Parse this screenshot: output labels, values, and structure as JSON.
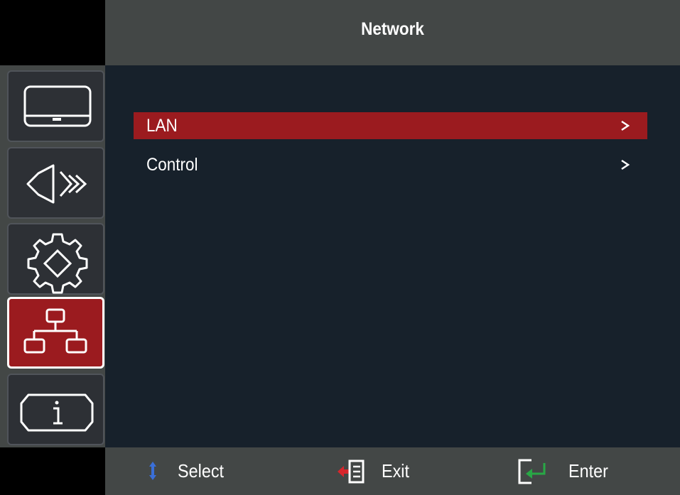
{
  "header": {
    "title": "Network"
  },
  "sidebar": {
    "tabs": [
      {
        "name": "display",
        "icon": "display-icon",
        "active": false
      },
      {
        "name": "audio",
        "icon": "speaker-icon",
        "active": false
      },
      {
        "name": "setup",
        "icon": "gear-icon",
        "active": false
      },
      {
        "name": "network",
        "icon": "network-icon",
        "active": true
      },
      {
        "name": "info",
        "icon": "info-icon",
        "active": false
      }
    ]
  },
  "menu": {
    "items": [
      {
        "label": "LAN",
        "selected": true
      },
      {
        "label": "Control",
        "selected": false
      }
    ]
  },
  "footer": {
    "select_label": "Select",
    "exit_label": "Exit",
    "enter_label": "Enter"
  },
  "colors": {
    "accent": "#9b1b1f",
    "panel": "#17212b",
    "chrome": "#434746"
  }
}
